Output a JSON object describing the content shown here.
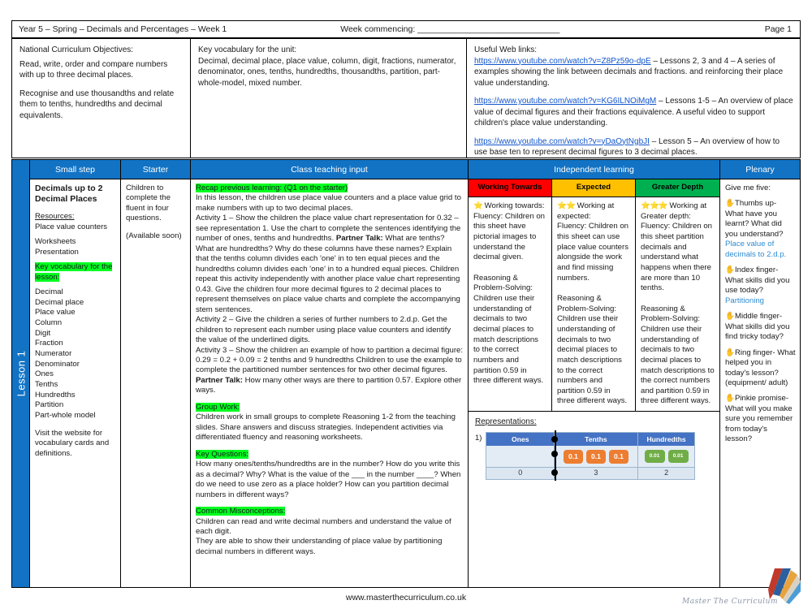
{
  "header": {
    "title": "Year 5 – Spring – Decimals and Percentages – Week 1",
    "week_commencing": "Week commencing: ______________________________",
    "page": "Page 1"
  },
  "objectives": {
    "label": "National Curriculum Objectives:",
    "items": [
      "Read, write, order and compare numbers with up to three decimal places.",
      "Recognise and use thousandths and relate them to tenths, hundredths and decimal equivalents."
    ]
  },
  "vocabulary": {
    "label": "Key vocabulary for the unit:",
    "text": "Decimal, decimal place, place value, column, digit, fractions, numerator, denominator, ones, tenths, hundredths, thousandths, partition, part-whole-model,  mixed number."
  },
  "weblinks": {
    "label": "Useful Web links:",
    "items": [
      {
        "url": "https://www.youtube.com/watch?v=Z8Pz59o-dpE",
        "desc": " – Lessons 2, 3 and 4 – A series of examples showing the link between decimals and fractions. and reinforcing their place value understanding."
      },
      {
        "url": "https://www.youtube.com/watch?v=KG6ILNOiMgM",
        "desc": " – Lessons 1-5 – An overview of place value of decimal figures and their fractions equivalence. A useful video to support children's place value understanding."
      },
      {
        "url": "https://www.youtube.com/watch?v=yDaOytNgbJI",
        "desc": " – Lesson 5 – An overview of how to use base ten to represent decimal figures to 3 decimal places."
      }
    ]
  },
  "table_headers": {
    "lesson_band": "Lesson 1",
    "small_step": "Small step",
    "starter": "Starter",
    "teaching": "Class teaching input",
    "independent": "Independent learning",
    "plenary": "Plenary"
  },
  "small_step": {
    "title": "Decimals up to 2 Decimal Places",
    "resources_label": "Resources:",
    "resources": [
      "Place value counters",
      "Worksheets",
      "Presentation"
    ],
    "vocab_label": "Key vocabulary for the lesson:",
    "vocab": [
      "Decimal",
      "Decimal place",
      "Place value",
      "Column",
      "Digit",
      "Fraction",
      "Numerator",
      "Denominator",
      "Ones",
      "Tenths",
      "Hundredths",
      "Partition",
      "Part-whole model"
    ],
    "note": "Visit the website for vocabulary cards and definitions."
  },
  "starter": {
    "line1": "Children to complete the fluent in four questions.",
    "line2": "(Available soon)"
  },
  "teaching": {
    "recap_label": "Recap previous learning: (Q1 on the starter)",
    "intro": "In this lesson, the children use place value counters and a place value grid to make numbers with up to two decimal places.",
    "activity1_a": "Activity 1 – Show the children the place value chart representation for 0.32 – see representation 1. Use the chart to complete the sentences identifying the number of ones, tenths and hundredths. ",
    "partner_talk_label": "Partner Talk:",
    "activity1_b": " What are tenths? What are hundredths? Why do these columns have these names? Explain that the tenths column divides each 'one' in to ten equal pieces and the hundredths column divides each 'one' in to a hundred equal pieces. Children repeat this activity independently with another place value chart representing 0.43. Give the children four more decimal figures to 2 decimal places to represent themselves on place value charts and complete the accompanying stem sentences.",
    "activity2": "Activity 2 – Give the children a series of further numbers to 2.d.p. Get the children to represent each number using place value counters and identify the value of the underlined digits.",
    "activity3_a": "Activity 3 – Show the children an example of how to partition a decimal figure: 0.29 = 0.2 + 0.09 = 2 tenths and 9 hundredths Children to use the example to complete the partitioned number sentences for two other decimal figures. ",
    "activity3_b": " How many other ways are there to partition 0.57. Explore other ways.",
    "group_work_label": "Group Work:",
    "group_work": "Children work in small groups to complete Reasoning 1-2 from the teaching slides. Share answers and discuss strategies. Independent activities via differentiated fluency and reasoning worksheets.",
    "key_questions_label": "Key Questions:",
    "key_questions": "How many ones/tenths/hundredths are in the number? How do you write this as a decimal? Why? What is the value of the ___ in the number ____? When do we need to use zero as a place holder? How can you partition decimal numbers in different ways?",
    "misconceptions_label": "Common Misconceptions:",
    "misconceptions_1": "Children can read and write decimal numbers and understand the value of each digit.",
    "misconceptions_2": "They are able to show their understanding of place value by partitioning decimal numbers in different ways."
  },
  "independent": {
    "columns": [
      {
        "badge": "Working Towards",
        "stars": "⭐",
        "heading": "Working towards:",
        "fluency": "Fluency: Children on this sheet have pictorial images to understand the decimal given.",
        "reasoning": "Reasoning & Problem-Solving: Children use their understanding of decimals to two decimal places to match descriptions to the correct numbers and partition 0.59 in three different ways."
      },
      {
        "badge": "Expected",
        "stars": "⭐⭐",
        "heading": "Working at expected:",
        "fluency": "Fluency: Children on this sheet can use place value counters alongside the work and find missing numbers.",
        "reasoning": "Reasoning & Problem-Solving: Children use their understanding of decimals to two decimal places to match descriptions to the correct numbers and partition 0.59 in three different ways."
      },
      {
        "badge": "Greater Depth",
        "stars": "⭐⭐⭐",
        "heading": "Working at Greater depth:",
        "fluency": "Fluency: Children on this sheet partition decimals and understand what happens when there are more than 10 tenths.",
        "reasoning": "Reasoning & Problem-Solving: Children use their understanding of decimals to two decimal places to match descriptions to the correct numbers and partition 0.59 in three different ways."
      }
    ],
    "representations_label": "Representations:",
    "rep_number": "1)"
  },
  "chart_data": {
    "type": "table",
    "title": "Place value chart representing 0.32",
    "categories": [
      "Ones",
      "Tenths",
      "Hundredths"
    ],
    "values": [
      0,
      3,
      2
    ],
    "counters": {
      "ones": [],
      "tenths": [
        "0.1",
        "0.1",
        "0.1"
      ],
      "hundredths": [
        "0.01",
        "0.01"
      ]
    },
    "colors": {
      "header": "#4472c4",
      "tenths": "#ed7d31",
      "hundredths": "#70ad47"
    },
    "decimal_point": true
  },
  "plenary": {
    "intro": "Give me five:",
    "items": [
      {
        "hand": "✋",
        "q": "Thumbs up- What have you learnt? What did you understand?",
        "answer": "Place value of decimals to 2.d.p."
      },
      {
        "hand": "✋",
        "q": "Index finger- What skills did you use today?",
        "answer": "Partitioning"
      },
      {
        "hand": "✋",
        "q": "Middle finger- What skills did you find tricky today?",
        "answer": ""
      },
      {
        "hand": "✋",
        "q": "Ring finger- What helped you in today's lesson? (equipment/ adult)",
        "answer": ""
      },
      {
        "hand": "✋",
        "q": "Pinkie promise- What will you make sure you remember from today's lesson?",
        "answer": ""
      }
    ]
  },
  "footer": {
    "url": "www.masterthecurriculum.co.uk",
    "logo_text": "Master The Curriculum"
  }
}
